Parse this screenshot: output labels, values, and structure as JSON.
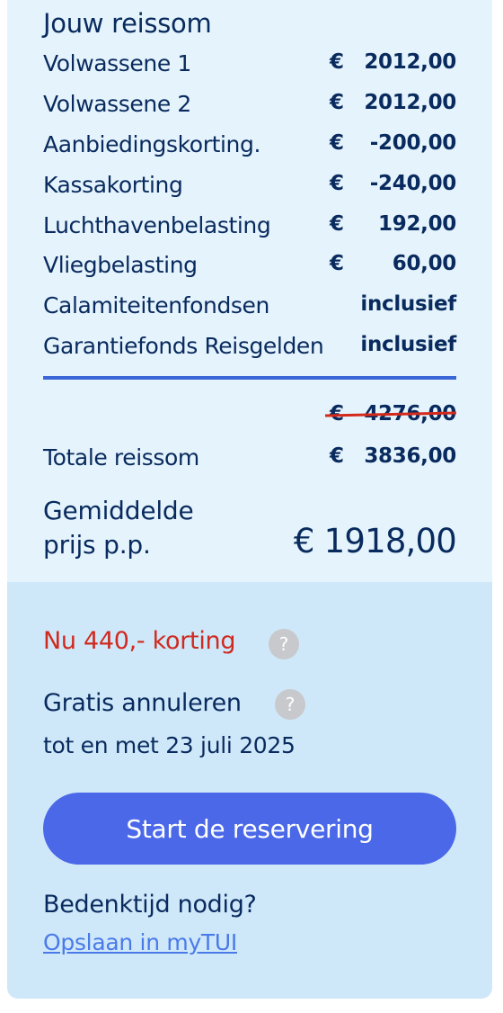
{
  "summary": {
    "title": "Jouw reissom",
    "currency": "€",
    "rows": [
      {
        "label": "Volwassene 1",
        "currency": "€",
        "amount": "2012,00"
      },
      {
        "label": "Volwassene 2",
        "currency": "€",
        "amount": "2012,00"
      },
      {
        "label": "Aanbiedingskorting.",
        "currency": "€",
        "amount": "-200,00"
      },
      {
        "label": "Kassakorting",
        "currency": "€",
        "amount": "-240,00"
      },
      {
        "label": "Luchthavenbelasting",
        "currency": "€",
        "amount": "192,00"
      },
      {
        "label": "Vliegbelasting",
        "currency": "€",
        "amount": "60,00"
      },
      {
        "label": "Calamiteitenfondsen",
        "currency": "",
        "amount": "inclusief"
      },
      {
        "label": "Garantiefonds Reisgelden",
        "currency": "",
        "amount": "inclusief"
      }
    ],
    "original_total": {
      "currency": "€",
      "amount": "4276,00"
    },
    "total": {
      "label": "Totale reissom",
      "currency": "€",
      "amount": "3836,00"
    },
    "average": {
      "label_line1": "Gemiddelde",
      "label_line2": "prijs p.p.",
      "price": "€ 1918,00"
    }
  },
  "offer": {
    "discount_text": "Nu 440,- korting",
    "help_symbol": "?",
    "cancel_title": "Gratis annuleren",
    "cancel_date": "tot en met 23 juli 2025",
    "cta_label": "Start de reservering",
    "think_title": "Bedenktijd nodig?",
    "save_link": "Opslaan in myTUI"
  },
  "colors": {
    "text": "#092a5e",
    "accent_blue": "#4a68e8",
    "discount_red": "#cf2a1f",
    "top_background": "#e5f4fc",
    "bottom_background": "#cfe8f9"
  }
}
